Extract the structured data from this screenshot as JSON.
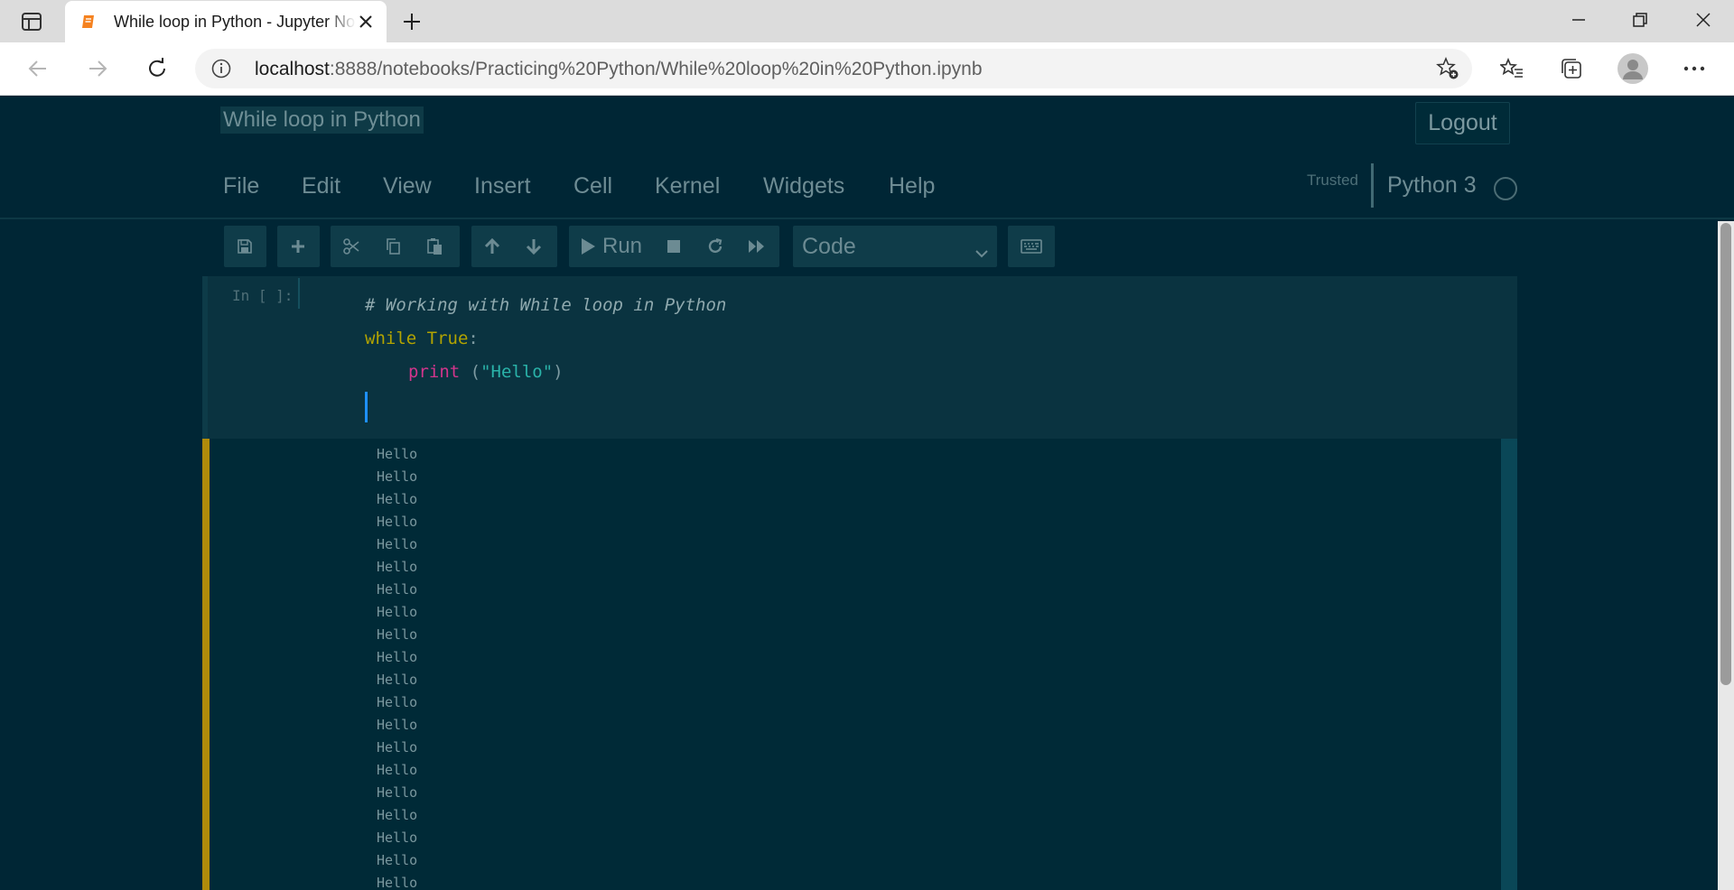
{
  "browser": {
    "tab_title": "While loop in Python - Jupyter Notebook",
    "url_host": "localhost",
    "url_rest": ":8888/notebooks/Practicing%20Python/While%20loop%20in%20Python.ipynb",
    "favicon_color": "#f58220"
  },
  "notebook": {
    "title": "While loop in Python",
    "logout_label": "Logout",
    "menu": [
      "File",
      "Edit",
      "View",
      "Insert",
      "Cell",
      "Kernel",
      "Widgets",
      "Help"
    ],
    "trusted_label": "Trusted",
    "kernel_name": "Python 3"
  },
  "toolbar": {
    "run_label": "Run",
    "cell_type": "Code"
  },
  "cell": {
    "prompt": "In [ ]:",
    "code": {
      "comment": "# Working with While loop in Python",
      "while_kw": "while",
      "true_kw": "True",
      "colon": ":",
      "print_fn": "print",
      "open_paren": "(",
      "string": "\"Hello\"",
      "close_paren": ")"
    },
    "output": [
      "Hello",
      "Hello",
      "Hello",
      "Hello",
      "Hello",
      "Hello",
      "Hello",
      "Hello",
      "Hello",
      "Hello",
      "Hello",
      "Hello",
      "Hello",
      "Hello",
      "Hello",
      "Hello",
      "Hello",
      "Hello",
      "Hello",
      "Hello"
    ]
  },
  "theme": {
    "background": "#002635",
    "accent_running": "#b08b0b",
    "cursor": "#1e90ff"
  }
}
